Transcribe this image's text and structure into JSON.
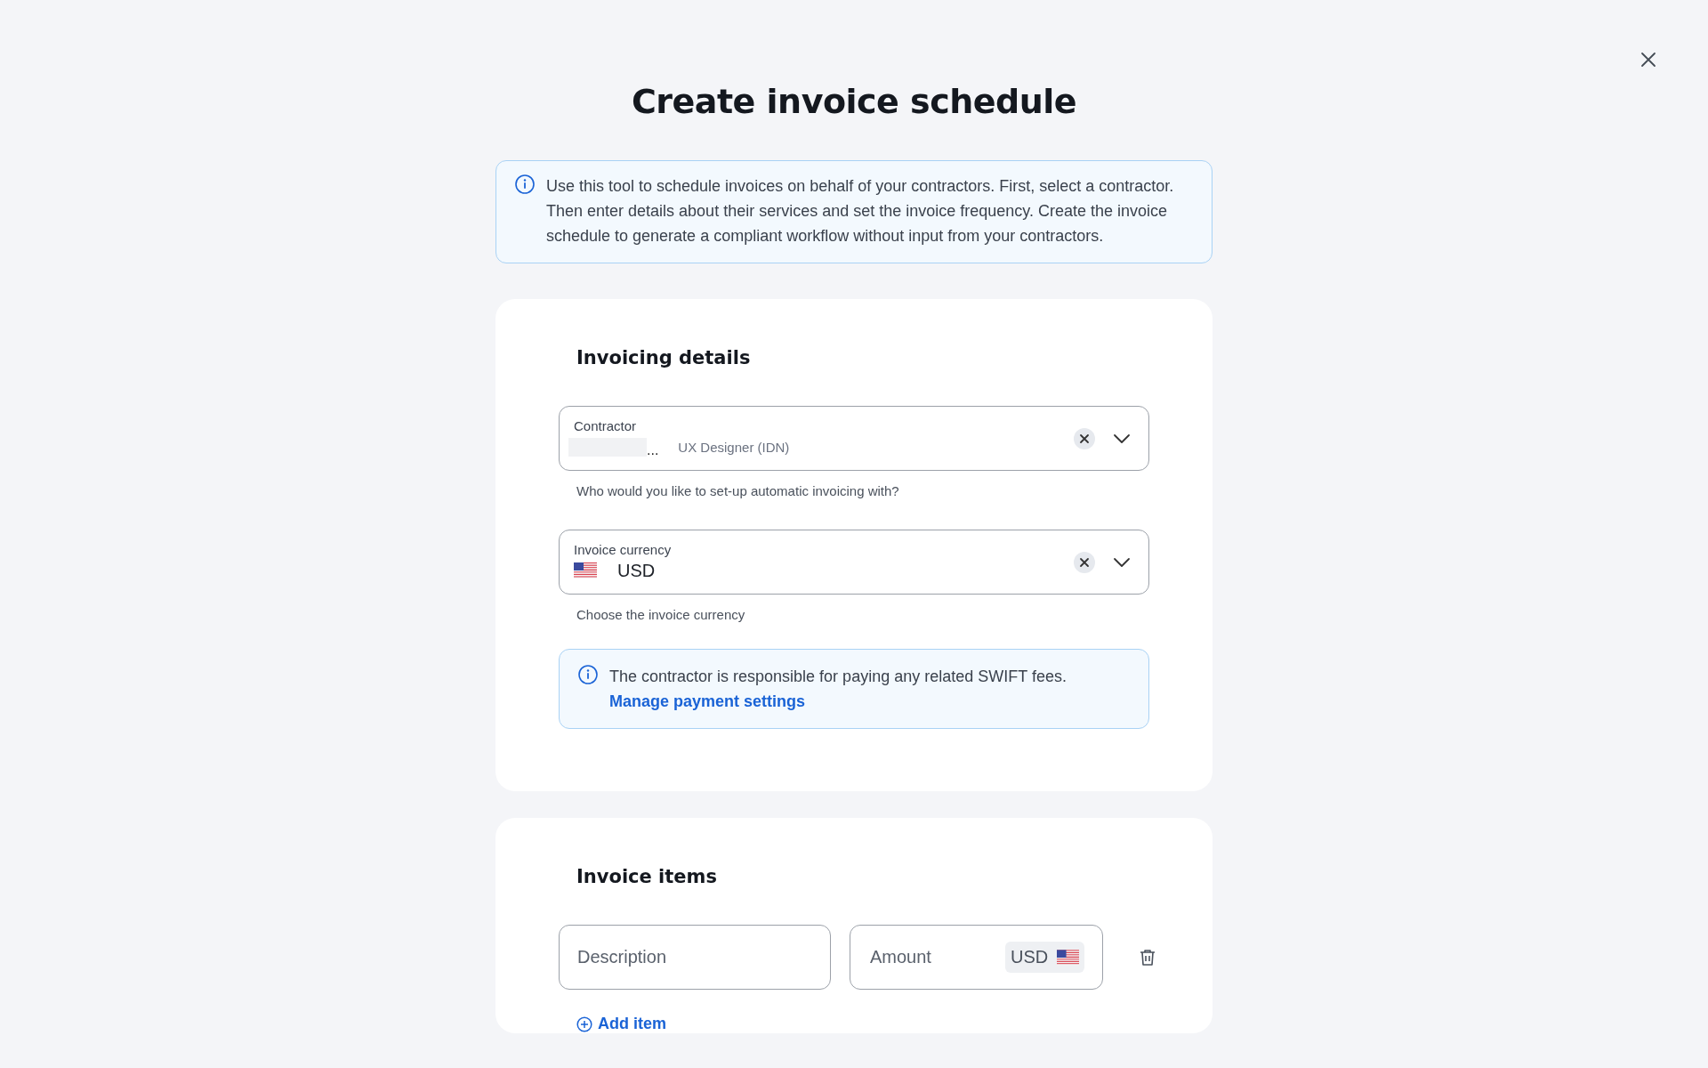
{
  "title": "Create invoice schedule",
  "intro": {
    "text": "Use this tool to schedule invoices on behalf of your contractors. First, select a contractor. Then enter details about their services and set the invoice frequency. Create the invoice schedule to generate a compliant workflow without input from your contractors."
  },
  "invoicing_details": {
    "heading": "Invoicing details",
    "fields": [
      {
        "kind": "contractor",
        "label": "Contractor",
        "value": "...",
        "secondary": "UX Designer (IDN)",
        "helper": "Who would you like to set-up automatic invoicing with?"
      },
      {
        "kind": "currency",
        "label": "Invoice currency",
        "value": "USD",
        "helper": "Choose the invoice currency"
      }
    ],
    "notice": {
      "text": "The contractor is responsible for paying any related SWIFT fees.",
      "link": "Manage payment settings"
    }
  },
  "invoice_items": {
    "heading": "Invoice items",
    "rows": [
      {
        "description": {
          "placeholder": "Description"
        },
        "amount": {
          "placeholder": "Amount",
          "currency": "USD"
        }
      }
    ],
    "add_label": "Add item"
  }
}
